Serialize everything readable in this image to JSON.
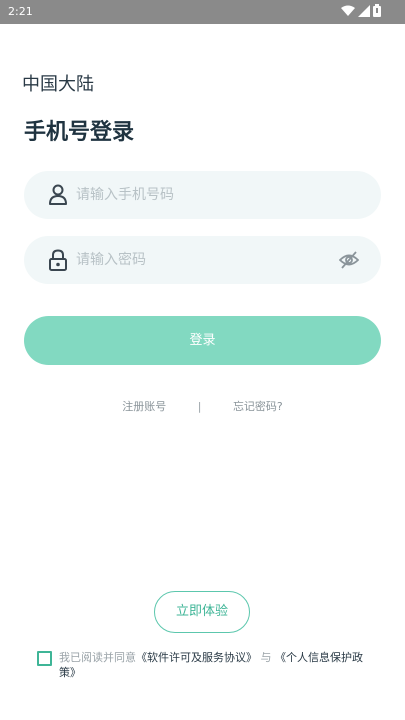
{
  "status_bar": {
    "time": "2:21",
    "icons": [
      "wifi-icon",
      "signal-icon",
      "battery-icon"
    ]
  },
  "region": "中国大陆",
  "title": "手机号登录",
  "phone": {
    "placeholder": "请输入手机号码",
    "icon": "user-icon"
  },
  "password": {
    "placeholder": "请输入密码",
    "icon": "lock-icon",
    "toggle_icon": "eye-off-icon"
  },
  "login_button": "登录",
  "links": {
    "register": "注册账号",
    "separator": "|",
    "forgot": "忘记密码?"
  },
  "try_button": "立即体验",
  "agreement": {
    "prefix": "我已阅读并同意",
    "license": "《软件许可及服务协议》",
    "conj": "与",
    "privacy": "《个人信息保护政策》"
  },
  "colors": {
    "accent": "#82d9c1",
    "accent_dark": "#3fb597",
    "field_bg": "#f1f7f8"
  }
}
